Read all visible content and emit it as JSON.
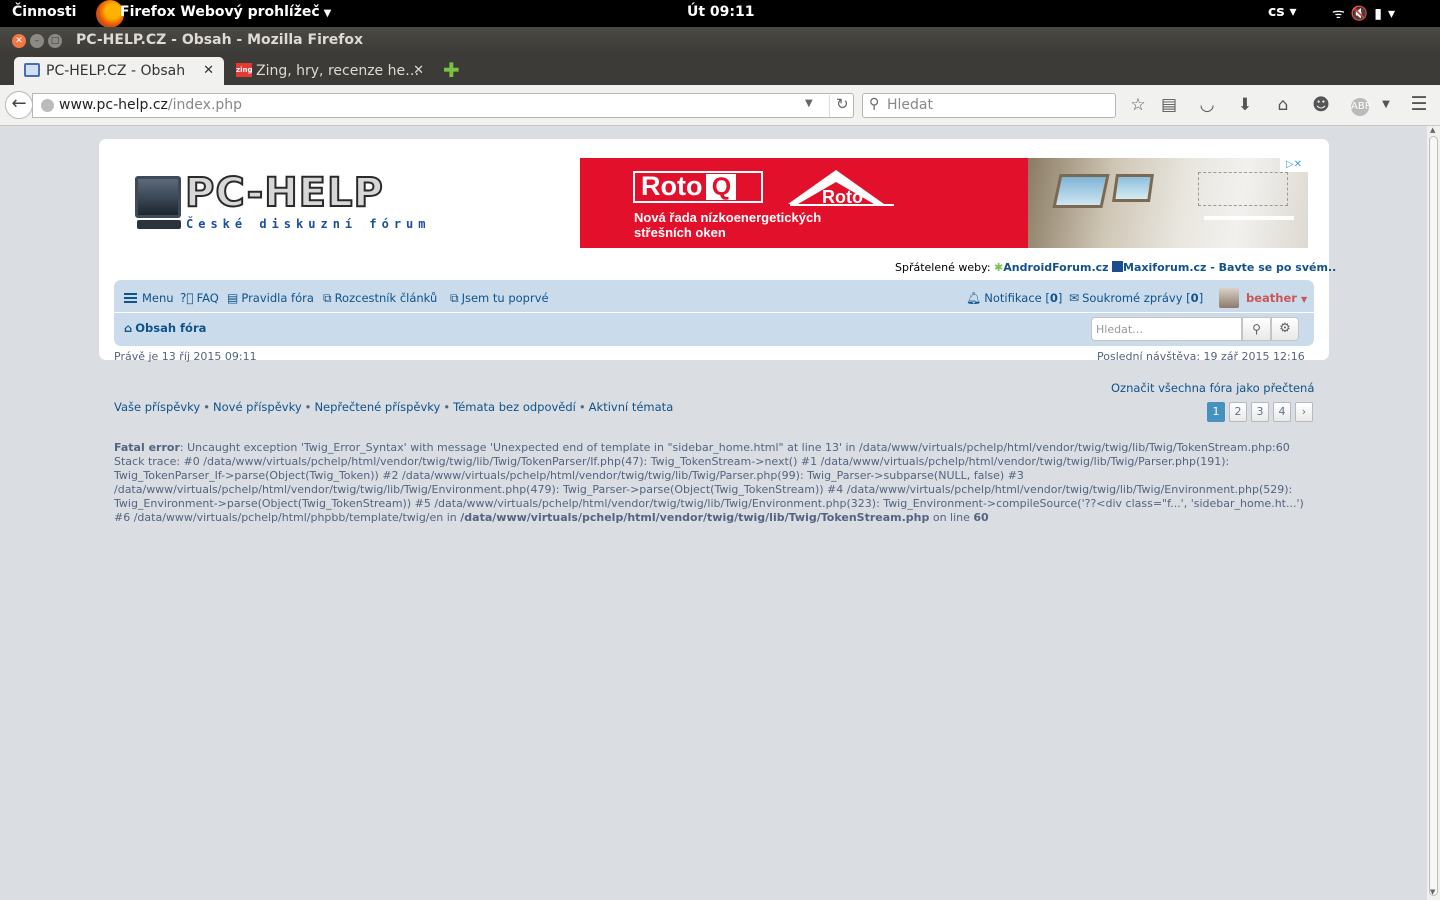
{
  "gnome": {
    "activities": "Činnosti",
    "app_name": "Firefox Webový prohlížeč",
    "clock": "Út 09:11",
    "lang": "cs"
  },
  "window": {
    "title": "PC-HELP.CZ - Obsah - Mozilla Firefox"
  },
  "tabs": [
    {
      "label": "PC-HELP.CZ - Obsah",
      "active": true
    },
    {
      "label": "Zing, hry, recenze he…",
      "active": false
    }
  ],
  "navbar": {
    "url_host": "www.pc-help.cz",
    "url_path": "/index.php",
    "search_placeholder": "Hledat",
    "icons": [
      "star-icon",
      "reading-list-icon",
      "pocket-icon",
      "download-icon",
      "home-icon",
      "chat-icon",
      "adblock-icon",
      "menu-icon"
    ]
  },
  "site": {
    "logo_text": "PC-HELP",
    "logo_subtitle": "České diskuzní fórum",
    "ad": {
      "brand": "Roto",
      "brand_q": "Q",
      "brand2": "Roto",
      "line1": "Nová řada nízkoenergetických",
      "line2": "střešních oken",
      "colors": {
        "background": "#e3102c"
      }
    },
    "friends_label": "Spřátelené weby:",
    "friends": [
      {
        "label": "AndroidForum.cz"
      },
      {
        "label": "Maxiforum.cz - Bavte se po svém.."
      }
    ],
    "nav": {
      "menu": "Menu",
      "faq": "FAQ",
      "rules": "Pravidla fóra",
      "articles": "Rozcestník článků",
      "first_time": "Jsem tu poprvé",
      "notifications": "Notifikace",
      "notifications_count": "0",
      "pm": "Soukromé zprávy",
      "pm_count": "0",
      "username": "beather",
      "breadcrumb": "Obsah fóra",
      "search_placeholder": "Hledat…"
    },
    "now": "Právě je 13 říj 2015 09:11",
    "last_visit": "Poslední návštěva: 19 zář 2015 12:16",
    "mark_read": "Označit všechna fóra jako přečtená",
    "quicklinks": [
      "Vaše příspěvky",
      "Nové příspěvky",
      "Nepřečtené příspěvky",
      "Témata bez odpovědí",
      "Aktivní témata"
    ],
    "quicklinks_sep": "•",
    "pagination": [
      "1",
      "2",
      "3",
      "4"
    ],
    "pagination_current": "1",
    "error": {
      "label": "Fatal error",
      "message": ": Uncaught exception 'Twig_Error_Syntax' with message 'Unexpected end of template in \"sidebar_home.html\" at line 13' in /data/www/virtuals/pchelp/html/vendor/twig/twig/lib/Twig/TokenStream.php:60 Stack trace: #0 /data/www/virtuals/pchelp/html/vendor/twig/twig/lib/Twig/TokenParser/If.php(47): Twig_TokenStream->next() #1 /data/www/virtuals/pchelp/html/vendor/twig/twig/lib/Twig/Parser.php(191): Twig_TokenParser_If->parse(Object(Twig_Token)) #2 /data/www/virtuals/pchelp/html/vendor/twig/twig/lib/Twig/Parser.php(99): Twig_Parser->subparse(NULL, false) #3 /data/www/virtuals/pchelp/html/vendor/twig/twig/lib/Twig/Environment.php(479): Twig_Parser->parse(Object(Twig_TokenStream)) #4 /data/www/virtuals/pchelp/html/vendor/twig/twig/lib/Twig/Environment.php(529): Twig_Environment->parse(Object(Twig_TokenStream)) #5 /data/www/virtuals/pchelp/html/vendor/twig/twig/lib/Twig/Environment.php(323): Twig_Environment->compileSource('??<div class=\"f...', 'sidebar_home.ht...') #6 /data/www/virtuals/pchelp/html/phpbb/template/twig/en in ",
      "file": "/data/www/virtuals/pchelp/html/vendor/twig/twig/lib/Twig/TokenStream.php",
      "on_line": " on line ",
      "line": "60"
    }
  }
}
